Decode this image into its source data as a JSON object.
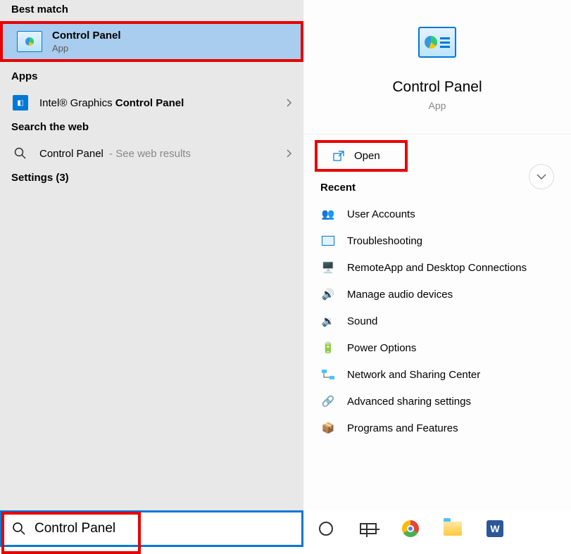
{
  "left": {
    "best_match_header": "Best match",
    "best_match": {
      "title": "Control Panel",
      "sub": "App"
    },
    "apps_header": "Apps",
    "apps_item_prefix": "Intel® Graphics ",
    "apps_item_bold": "Control Panel",
    "web_header": "Search the web",
    "web_item": "Control Panel",
    "web_suffix": " - See web results",
    "settings_header": "Settings (3)"
  },
  "right": {
    "title": "Control Panel",
    "sub": "App",
    "open_label": "Open",
    "recent_header": "Recent",
    "recent": [
      "User Accounts",
      "Troubleshooting",
      "RemoteApp and Desktop Connections",
      "Manage audio devices",
      "Sound",
      "Power Options",
      "Network and Sharing Center",
      "Advanced sharing settings",
      "Programs and Features"
    ]
  },
  "search": {
    "value": "Control Panel"
  },
  "taskbar": {
    "word": "W"
  }
}
